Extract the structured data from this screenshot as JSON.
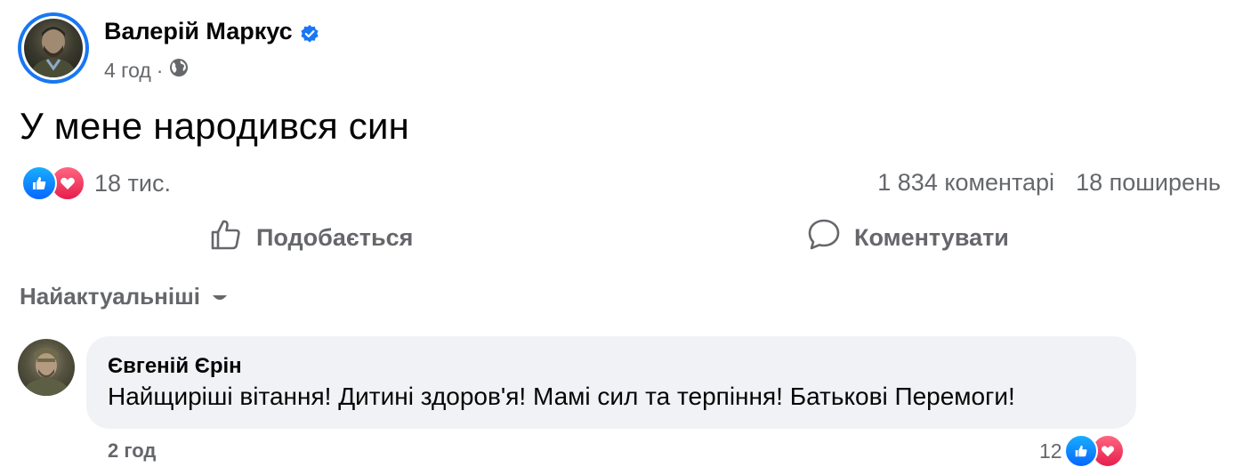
{
  "post": {
    "author": "Валерій Маркус",
    "time": "4 год",
    "separator": "·",
    "text": "У мене народився син",
    "reactions_count": "18 тис.",
    "comments_count": "1 834 коментарі",
    "shares_count": "18 поширень"
  },
  "actions": {
    "like_label": "Подобається",
    "comment_label": "Коментувати"
  },
  "sort": {
    "selected": "Найактуальніші"
  },
  "comment": {
    "author": "Євгеній Єрін",
    "text": "Найщиріші вітання! Дитині здоров'я! Мамі сил та терпіння! Батькові Перемоги!",
    "time": "2 год",
    "reactions_count": "12"
  },
  "icons": {
    "verified": "verified-badge-icon",
    "privacy": "globe-icon",
    "like_reaction": "like-reaction-icon",
    "love_reaction": "love-reaction-icon",
    "like_action": "thumbs-up-icon",
    "comment_action": "comment-bubble-icon",
    "sort_dropdown": "caret-down-icon"
  },
  "colors": {
    "accent": "#1877f2",
    "secondary_text": "#65676b",
    "bubble_bg": "#f0f2f5",
    "love": "#e61e4d"
  }
}
